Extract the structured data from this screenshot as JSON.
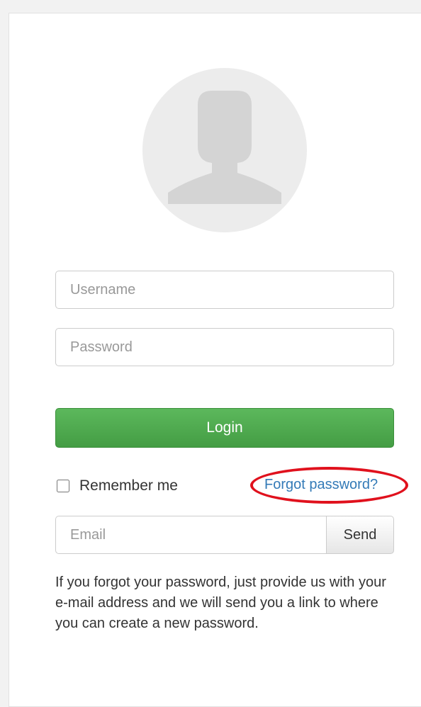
{
  "login_form": {
    "avatar_icon": "user-silhouette-icon",
    "username_placeholder": "Username",
    "password_placeholder": "Password",
    "login_label": "Login",
    "remember_label": "Remember me",
    "remember_checked": false,
    "forgot_label": "Forgot password?"
  },
  "reset_form": {
    "email_placeholder": "Email",
    "send_label": "Send",
    "help_text": "If you forgot your password, just provide us with your e-mail address and we will send you a link to where you can create a new password."
  },
  "colors": {
    "login_button": "#5cb85c",
    "link": "#337ab7",
    "highlight": "#e0111d",
    "avatar_bg": "#ececec",
    "avatar_fg": "#d4d4d4"
  }
}
